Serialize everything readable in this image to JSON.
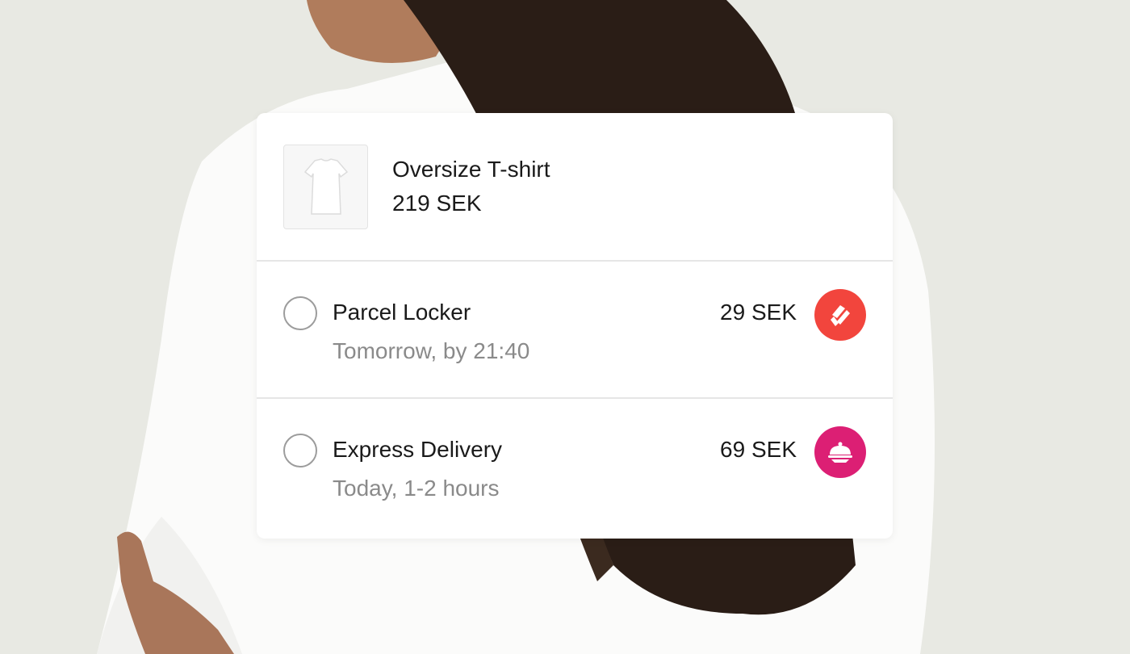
{
  "product": {
    "name": "Oversize T-shirt",
    "price": "219 SEK",
    "image_icon": "tshirt-image"
  },
  "delivery_options": [
    {
      "title": "Parcel Locker",
      "subtitle": "Tomorrow, by 21:40",
      "price": "29 SEK",
      "carrier_icon": "parcel-locker-logo",
      "carrier_color": "#f2453d",
      "selected": false
    },
    {
      "title": "Express Delivery",
      "subtitle": "Today, 1-2 hours",
      "price": "69 SEK",
      "carrier_icon": "food-cloche-logo",
      "carrier_color": "#dc1f74",
      "selected": false
    }
  ],
  "colors": {
    "card_background": "#ffffff",
    "divider": "#e6e6e6",
    "secondary_text": "#8a8a8a"
  }
}
